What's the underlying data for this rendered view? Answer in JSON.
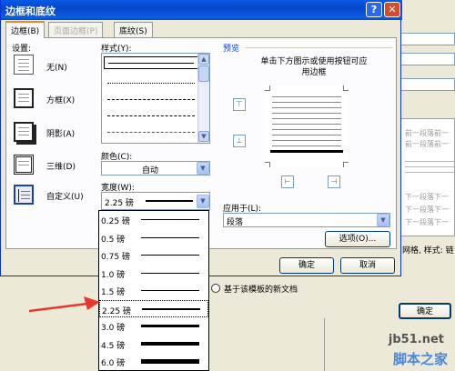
{
  "dialog": {
    "title": "边框和底纹",
    "help_label": "?",
    "close_label": "✕",
    "tabs": [
      {
        "label": "边框(B)"
      },
      {
        "label": "页面边框(P)"
      },
      {
        "label": "底纹(S)"
      }
    ]
  },
  "settings": {
    "heading": "设置:",
    "items": [
      {
        "label": "无(N)"
      },
      {
        "label": "方框(X)"
      },
      {
        "label": "阴影(A)"
      },
      {
        "label": "三维(D)"
      },
      {
        "label": "自定义(U)"
      }
    ]
  },
  "style": {
    "heading": "样式(Y):"
  },
  "color": {
    "heading": "颜色(C):",
    "value": "自动"
  },
  "width": {
    "heading": "宽度(W):",
    "value": "2.25 磅",
    "options": [
      {
        "label": "0.25 磅",
        "pt": 0.25
      },
      {
        "label": "0.5 磅",
        "pt": 0.5
      },
      {
        "label": "0.75 磅",
        "pt": 0.75
      },
      {
        "label": "1.0 磅",
        "pt": 1.0
      },
      {
        "label": "1.5 磅",
        "pt": 1.5
      },
      {
        "label": "2.25 磅",
        "pt": 2.25
      },
      {
        "label": "3.0 磅",
        "pt": 3.0
      },
      {
        "label": "4.5 磅",
        "pt": 4.5
      },
      {
        "label": "6.0 磅",
        "pt": 6.0
      }
    ],
    "selected_index": 5
  },
  "preview": {
    "heading": "预览",
    "instruction": "单击下方图示或使用按钮可应用边框",
    "apply_to_label": "应用于(L):",
    "apply_to_value": "段落",
    "options_button": "选项(O)..."
  },
  "buttons": {
    "ok": "确定",
    "cancel": "取消",
    "bg_ok": "确定"
  },
  "background": {
    "template_text": "基于该模板的新文档",
    "side_text_1": "前一段落前一",
    "side_text_2": "下一段落下一",
    "side_text_3": "网格, 样式: 链"
  },
  "watermark": {
    "line1": "jb51.net",
    "line2": "脚本之家"
  }
}
